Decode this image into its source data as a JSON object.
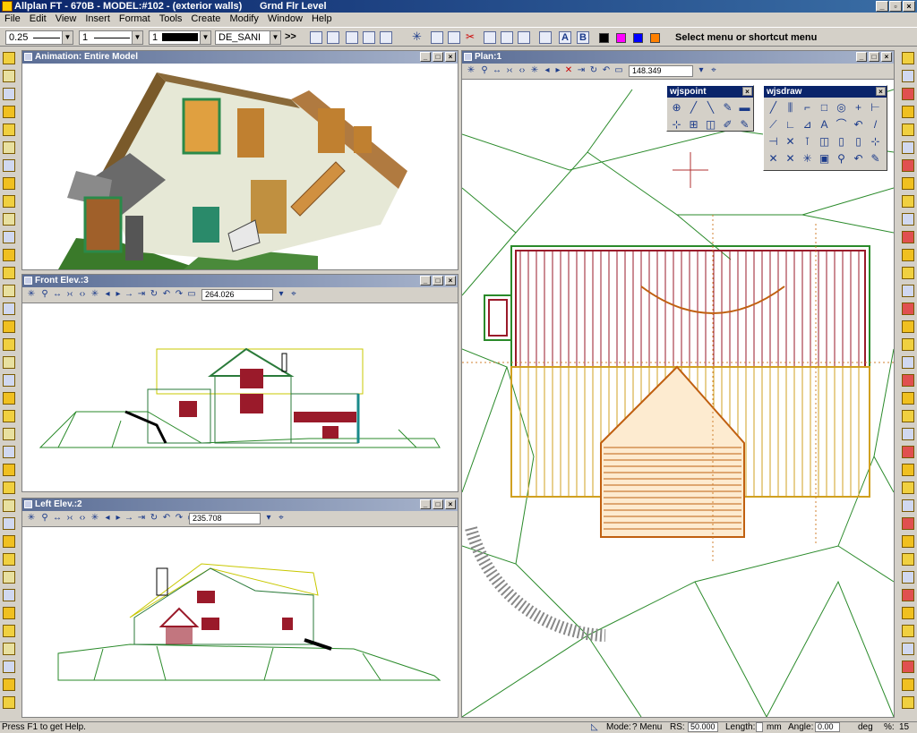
{
  "titlebar": {
    "title": "Allplan FT - 670B - MODEL:#102 - (exterior walls)",
    "level": "Grnd Flr Level"
  },
  "menu": [
    "File",
    "Edit",
    "View",
    "Insert",
    "Format",
    "Tools",
    "Create",
    "Modify",
    "Window",
    "Help"
  ],
  "toolbar": {
    "pen_thickness": "0.25",
    "line_type": "1",
    "color_index": "1",
    "layer": "DE_SANI",
    "hint": "Select menu or shortcut menu"
  },
  "swatch_colors": [
    "#000000",
    "#ff00ff",
    "#0000ff",
    "#ff8000"
  ],
  "windows": {
    "animation": {
      "title": "Animation: Entire Model"
    },
    "front": {
      "title": "Front Elev.:3",
      "zoom": "264.026"
    },
    "left": {
      "title": "Left Elev.:2",
      "zoom": "235.708"
    },
    "plan": {
      "title": "Plan:1",
      "zoom": "148.349"
    }
  },
  "palettes": {
    "wjspoint": {
      "title": "wjspoint"
    },
    "wjsdraw": {
      "title": "wjsdraw"
    }
  },
  "status": {
    "help": "Press F1 to get Help.",
    "mode_label": "Mode:",
    "mode_value": "? Menu",
    "rs_label": "RS:",
    "rs_value": "50.000",
    "length_label": "Length:",
    "length_unit": "mm",
    "angle_label": "Angle:",
    "angle_value": "0.00",
    "angle_unit": "deg",
    "pct_label": "%:",
    "pct_value": "15"
  }
}
